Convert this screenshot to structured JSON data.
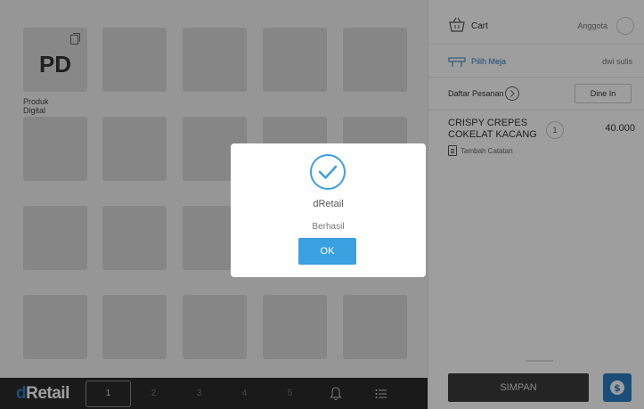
{
  "product_grid": {
    "first_tile": {
      "initials": "PD",
      "label": "Produk Digital"
    }
  },
  "bottom_bar": {
    "logo_prefix": "d",
    "logo_rest": "Retail",
    "pages": [
      "1",
      "2",
      "3",
      "4",
      "5"
    ],
    "active_page": "1",
    "icons": [
      "bell-icon",
      "menu-list-icon"
    ]
  },
  "cart_panel": {
    "cart_label": "Cart",
    "member_label": "Anggota",
    "table_label": "Pilih Meja",
    "user_name": "dwi sulis",
    "order_list_label": "Daftar Pesanan",
    "dine_mode": "Dine In",
    "items": [
      {
        "name": "CRISPY CREPES COKELAT KACANG",
        "qty": "1",
        "price": "40.000",
        "note_label": "Tambah Catatan"
      }
    ],
    "save_label": "SIMPAN",
    "pay_icon": "dollar-icon"
  },
  "dialog": {
    "title": "dRetail",
    "message": "Berhasil",
    "ok_label": "OK",
    "icon": "check-circle-icon"
  },
  "colors": {
    "accent": "#2b7ec2",
    "ok_button": "#3aa0e0",
    "bottom_bar": "#2b2b2b"
  }
}
